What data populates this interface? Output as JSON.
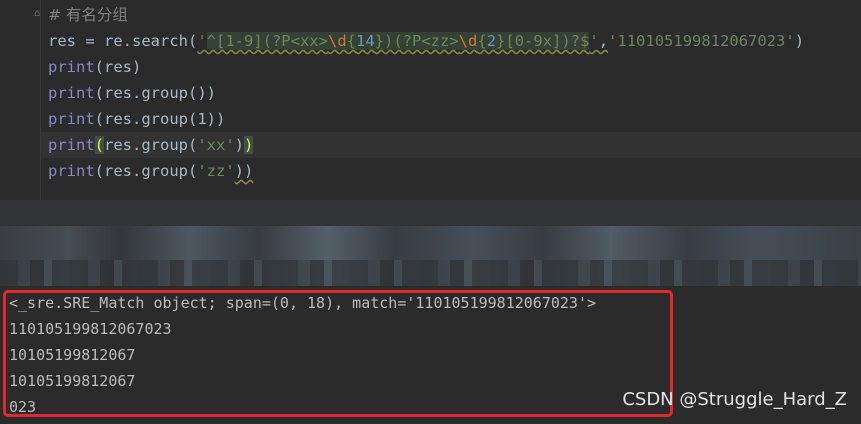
{
  "editor": {
    "comment_hash": "#",
    "comment_text": " 有名分组",
    "line1": {
      "prefix": "res = re.search(",
      "q1": "'",
      "r1": "^[1-9](?P<xx>",
      "r2": "\\d",
      "r3": "{",
      "r4": "14",
      "r5": "})(?P<zz>",
      "r6": "\\d",
      "r7": "{",
      "r8": "2",
      "r9": "}[0-9x])?$",
      "q2": "'",
      "comma": ",",
      "arg2": "'110105199812067023'",
      "suffix": ")"
    },
    "line2": {
      "fn": "print",
      "rest": "(res)"
    },
    "line3": {
      "fn": "print",
      "rest": "(res.group())"
    },
    "line4": {
      "fn": "print",
      "rest": "(res.group(1))"
    },
    "line5": {
      "fn": "print",
      "open": "(",
      "mid": "res.group(",
      "str": "'xx'",
      "close1": ")",
      "close2": ")"
    },
    "line6": {
      "fn": "print",
      "mid": "(res.group(",
      "str": "'zz'",
      "close": "))"
    }
  },
  "console": {
    "lines": [
      "<_sre.SRE_Match object; span=(0, 18), match='110105199812067023'>",
      "110105199812067023",
      "10105199812067",
      "10105199812067",
      "023"
    ]
  },
  "watermark": "CSDN @Struggle_Hard_Z",
  "colors": {
    "highlight": "#e8262a",
    "background": "#2b2b2b"
  }
}
